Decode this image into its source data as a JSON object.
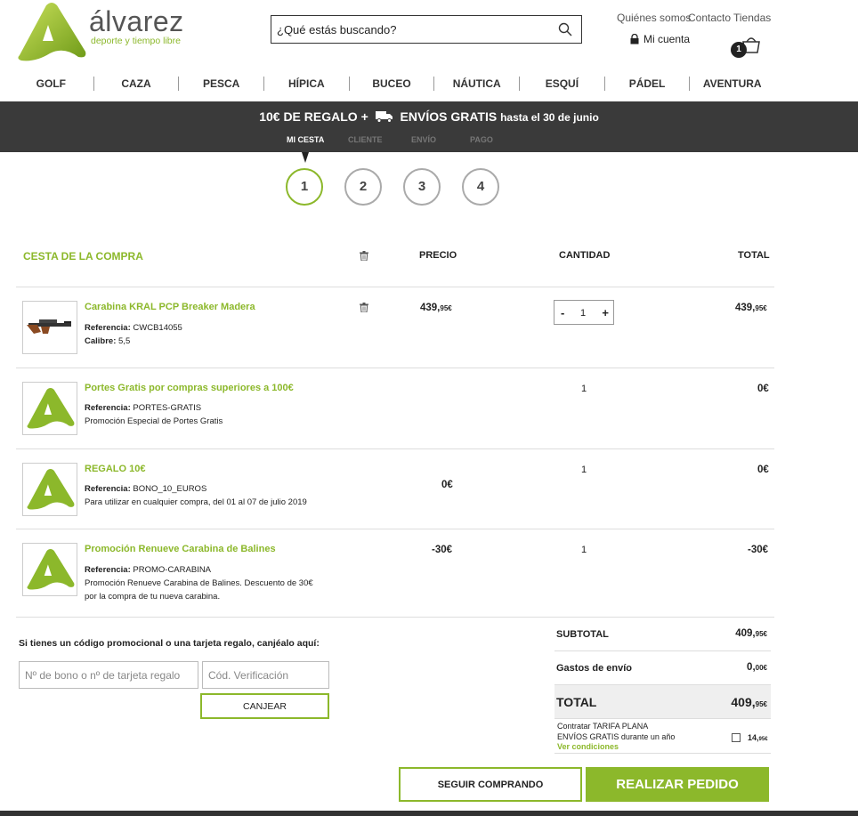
{
  "header": {
    "brand": "álvarez",
    "tagline": "deporte y tiempo libre",
    "search_placeholder": "¿Qué estás buscando?",
    "links": [
      "Quiénes somos",
      "Contacto",
      "Tiendas"
    ],
    "account_label": "Mi cuenta",
    "cart_count": "1",
    "accent_color": "#8cb82b"
  },
  "nav": [
    "GOLF",
    "CAZA",
    "PESCA",
    "HÍPICA",
    "BUCEO",
    "NÁUTICA",
    "ESQUÍ",
    "PÁDEL",
    "AVENTURA"
  ],
  "promo": {
    "part1": "10€ DE REGALO +",
    "part2": "ENVÍOS GRATIS",
    "part3": "hasta el 30 de junio"
  },
  "steps": {
    "labels": [
      "MI CESTA",
      "CLIENTE",
      "ENVÍO",
      "PAGO"
    ],
    "numbers": [
      "1",
      "2",
      "3",
      "4"
    ],
    "active_index": 0
  },
  "cart": {
    "title": "CESTA DE LA COMPRA",
    "col_price": "PRECIO",
    "col_qty": "CANTIDAD",
    "col_total": "TOTAL",
    "items": [
      {
        "name": "Carabina KRAL PCP Breaker Madera",
        "ref_label": "Referencia:",
        "ref": "CWCB14055",
        "extra_label": "Calibre:",
        "extra": "5,5",
        "price_int": "439,",
        "price_dec": "95€",
        "qty": "1",
        "total_int": "439,",
        "total_dec": "95€"
      },
      {
        "name": "Portes Gratis por compras superiores a 100€",
        "ref_label": "Referencia:",
        "ref": "PORTES-GRATIS",
        "desc": "Promoción Especial de Portes Gratis",
        "qty": "1",
        "total": "0€"
      },
      {
        "name": "REGALO 10€",
        "ref_label": "Referencia:",
        "ref": "BONO_10_EUROS",
        "desc": "Para utilizar en cualquier compra, del 01 al 07 de julio 2019",
        "price": "0€",
        "qty": "1",
        "total": "0€"
      },
      {
        "name": "Promoción Renueve Carabina de Balines",
        "ref_label": "Referencia:",
        "ref": "PROMO-CARABINA",
        "desc1": "Promoción Renueve Carabina de Balines. Descuento de 30€",
        "desc2": "por la compra de tu nueva carabina.",
        "price": "-30€",
        "qty": "1",
        "total": "-30€"
      }
    ]
  },
  "coupon": {
    "label": "Si tienes un código promocional o una tarjeta regalo, canjéalo aquí:",
    "code_placeholder": "Nº de bono o nº de tarjeta regalo",
    "verif_placeholder": "Cód. Verificación",
    "button": "CANJEAR"
  },
  "summary": {
    "subtotal_label": "SUBTOTAL",
    "subtotal_int": "409,",
    "subtotal_dec": "95€",
    "shipping_label": "Gastos de envío",
    "shipping_int": "0,",
    "shipping_dec": "00€",
    "total_label": "TOTAL",
    "total_int": "409,",
    "total_dec": "95€",
    "flat_line1": "Contratar TARIFA PLANA",
    "flat_line2": "ENVÍOS GRATIS durante un año",
    "flat_link": "Ver condiciones",
    "flat_price_int": "14,",
    "flat_price_dec": "95€"
  },
  "actions": {
    "continue": "SEGUIR COMPRANDO",
    "checkout": "REALIZAR PEDIDO"
  }
}
